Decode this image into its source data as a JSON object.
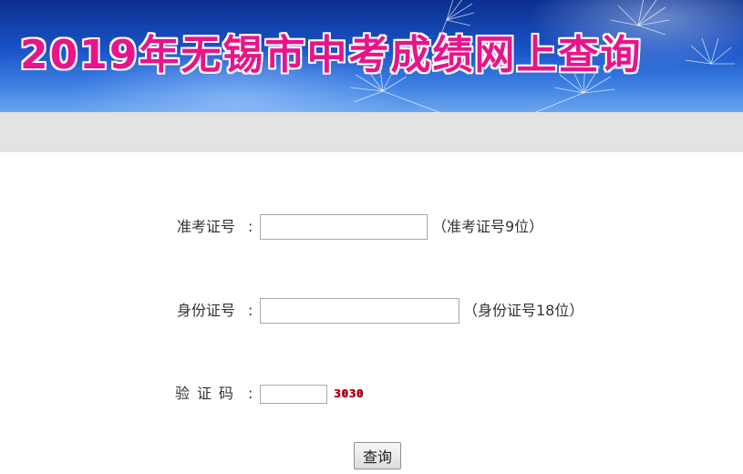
{
  "banner": {
    "title": "2019年无锡市中考成绩网上查询"
  },
  "form": {
    "exam_id": {
      "label": "准考证号",
      "colon": ":",
      "value": "",
      "hint": "（准考证号9位）"
    },
    "id_card": {
      "label": "身份证号",
      "colon": ":",
      "value": "",
      "hint": "（身份证号18位）"
    },
    "captcha": {
      "label": "验证码",
      "colon": ":",
      "value": "",
      "image_text": "3030"
    },
    "submit_label": "查询"
  },
  "colors": {
    "title": "#e8148a",
    "banner_blue": "#1a54c8",
    "grey_bar": "#e3e3e3",
    "captcha_text": "#c0001a"
  }
}
